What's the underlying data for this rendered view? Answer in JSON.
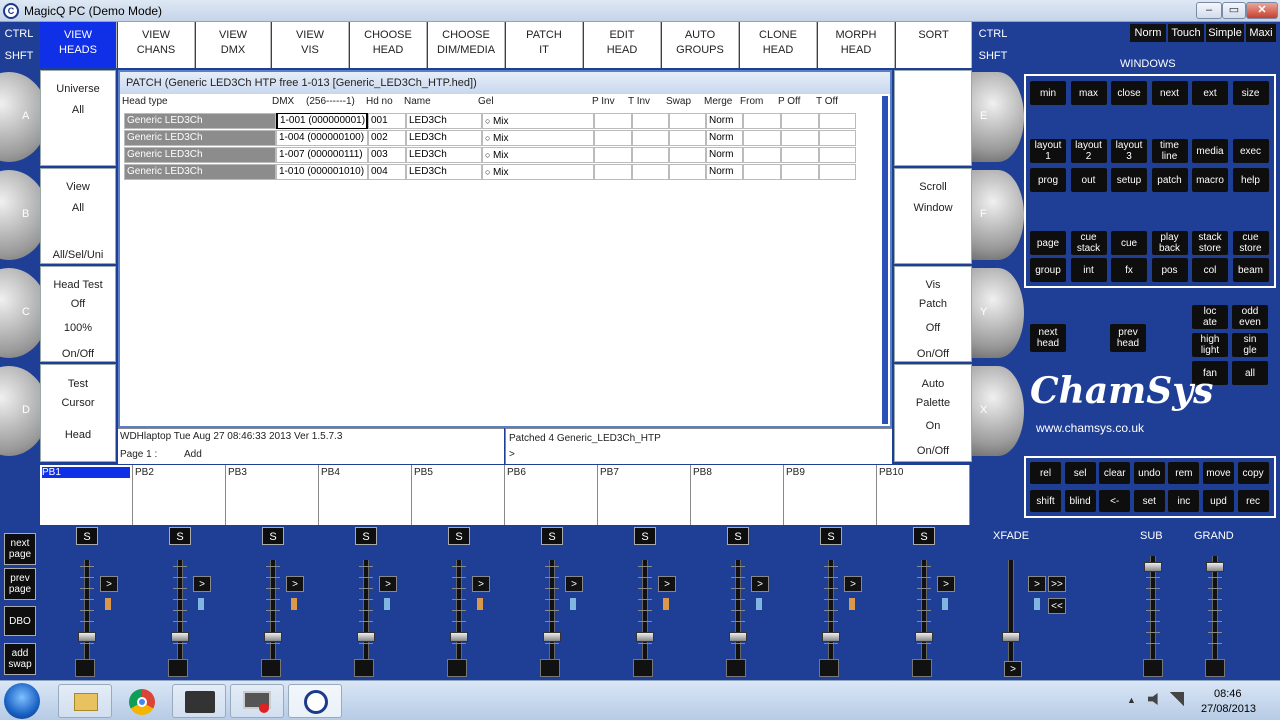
{
  "window": {
    "title": "MagicQ PC (Demo Mode)",
    "minimize": "–",
    "restore": "▭",
    "close": "✕"
  },
  "left_modifiers": {
    "ctrl": "CTRL",
    "shft": "SHFT"
  },
  "right_modifiers": {
    "ctrl": "CTRL",
    "shft": "SHFT"
  },
  "top_buttons": [
    {
      "label": "VIEW\nHEADS",
      "active": true
    },
    {
      "label": "VIEW\nCHANS"
    },
    {
      "label": "VIEW\nDMX"
    },
    {
      "label": "VIEW\nVIS"
    },
    {
      "label": "CHOOSE\nHEAD"
    },
    {
      "label": "CHOOSE\nDIM/MEDIA"
    },
    {
      "label": "PATCH\nIT"
    },
    {
      "label": "EDIT\nHEAD"
    },
    {
      "label": "AUTO\nGROUPS"
    },
    {
      "label": "CLONE\nHEAD"
    },
    {
      "label": "MORPH\nHEAD"
    },
    {
      "label": "SORT"
    }
  ],
  "left_soft": {
    "a": {
      "line1": "Universe",
      "line2": "All"
    },
    "b": {
      "line1": "View",
      "line2": "All",
      "line3": "All/Sel/Uni"
    },
    "c": {
      "line1": "Head Test",
      "line2": "Off",
      "line3": "100%",
      "line4": "On/Off"
    },
    "d": {
      "line1": "Test",
      "line2": "Cursor",
      "line3": "Head"
    }
  },
  "right_soft": {
    "e": {
      "line1": ""
    },
    "f": {
      "line1": "Scroll",
      "line2": "Window"
    },
    "y": {
      "line1": "Vis",
      "line2": "Patch",
      "line3": "Off",
      "line4": "On/Off"
    },
    "x": {
      "line1": "Auto",
      "line2": "Palette",
      "line3": "On",
      "line4": "On/Off"
    }
  },
  "knob_letters": {
    "a": "A",
    "b": "B",
    "c": "C",
    "d": "D",
    "e": "E",
    "f": "F",
    "y": "Y",
    "x": "X"
  },
  "patch": {
    "title": "PATCH (Generic LED3Ch HTP free 1-013 [Generic_LED3Ch_HTP.hed])",
    "headers": {
      "head_type": "Head type",
      "dmx": "DMX",
      "dmx_range": "(256------1)",
      "hd_no": "Hd no",
      "name": "Name",
      "gel": "Gel",
      "p_inv": "P Inv",
      "t_inv": "T Inv",
      "swap": "Swap",
      "merge": "Merge",
      "from": "From",
      "p_off": "P Off",
      "t_off": "T Off"
    },
    "rows": [
      {
        "head_type": "Generic LED3Ch",
        "dmx": "1-001 (000000001)",
        "hd_no": "001",
        "name": "LED3Ch",
        "gel": "Mix",
        "merge": "Norm"
      },
      {
        "head_type": "Generic LED3Ch",
        "dmx": "1-004 (000000100)",
        "hd_no": "002",
        "name": "LED3Ch",
        "gel": "Mix",
        "merge": "Norm"
      },
      {
        "head_type": "Generic LED3Ch",
        "dmx": "1-007 (000000111)",
        "hd_no": "003",
        "name": "LED3Ch",
        "gel": "Mix",
        "merge": "Norm"
      },
      {
        "head_type": "Generic LED3Ch",
        "dmx": "1-010 (000001010)",
        "hd_no": "004",
        "name": "LED3Ch",
        "gel": "Mix",
        "merge": "Norm"
      }
    ]
  },
  "status": {
    "line1": "WDHlaptop   Tue Aug 27 08:46:33 2013 Ver 1.5.7.3",
    "page": "Page 1 :",
    "mode": "Add",
    "message": "Patched 4 Generic_LED3Ch_HTP",
    "prompt": ">"
  },
  "playbacks": [
    "PB1",
    "PB2",
    "PB3",
    "PB4",
    "PB5",
    "PB6",
    "PB7",
    "PB8",
    "PB9",
    "PB10"
  ],
  "modes": [
    "Norm",
    "Touch",
    "Simple",
    "Maxi"
  ],
  "windows": {
    "heading": "WINDOWS",
    "row1": [
      "min",
      "max",
      "close",
      "next",
      "ext",
      "size"
    ],
    "row2": [
      "layout\n1",
      "layout\n2",
      "layout\n3",
      "time\nline",
      "media",
      "exec"
    ],
    "row3": [
      "prog",
      "out",
      "setup",
      "patch",
      "macro",
      "help"
    ],
    "row4": [
      "page",
      "cue\nstack",
      "cue",
      "play\nback",
      "stack\nstore",
      "cue\nstore"
    ],
    "row5": [
      "group",
      "int",
      "fx",
      "pos",
      "col",
      "beam"
    ]
  },
  "head_nav": {
    "next": "next\nhead",
    "prev": "prev\nhead"
  },
  "select_btns": [
    [
      "loc\nate",
      "odd\neven"
    ],
    [
      "high\nlight",
      "sin\ngle"
    ],
    [
      "fan",
      "all"
    ]
  ],
  "brand": {
    "logo": "ChamSys",
    "url": "www.chamsys.co.uk"
  },
  "edit_keys": {
    "row1": [
      "rel",
      "sel",
      "clear",
      "undo",
      "rem",
      "move",
      "copy"
    ],
    "row2": [
      "shift",
      "blind",
      "<-",
      "set",
      "inc",
      "upd",
      "rec"
    ]
  },
  "left_column": [
    "next\npage",
    "prev\npage",
    "DBO",
    "add\nswap"
  ],
  "fader_labels": {
    "s": "S",
    "go": ">",
    "xfade": "XFADE",
    "sub": "SUB",
    "grand": "GRAND",
    "ff": ">>",
    "rw": "<<"
  },
  "taskbar": {
    "time": "08:46",
    "date": "27/08/2013",
    "tray_up": "▲"
  }
}
